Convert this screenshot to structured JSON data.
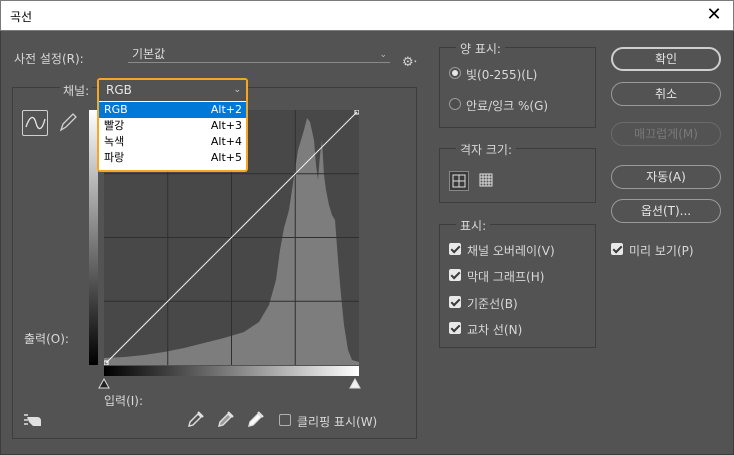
{
  "window": {
    "title": "곡선",
    "close_glyph": "✕"
  },
  "preset": {
    "label": "사전 설정(R):",
    "value": "기본값"
  },
  "channel": {
    "label": "채널:",
    "selected": "RGB",
    "options": [
      {
        "name": "RGB",
        "shortcut": "Alt+2"
      },
      {
        "name": "빨강",
        "shortcut": "Alt+3"
      },
      {
        "name": "녹색",
        "shortcut": "Alt+4"
      },
      {
        "name": "파랑",
        "shortcut": "Alt+5"
      }
    ]
  },
  "graph": {
    "output_label": "출력(O):",
    "input_label": "입력(I):"
  },
  "clipping": {
    "label": "클리핑 표시(W)",
    "checked": false
  },
  "amount": {
    "title": "양 표시:",
    "options": [
      {
        "label": "빛(0-255)(L)",
        "selected": true
      },
      {
        "label": "안료/잉크 %(G)",
        "selected": false
      }
    ]
  },
  "grid_size": {
    "title": "격자 크기:"
  },
  "display": {
    "title": "표시:",
    "options": [
      {
        "label": "채널 오버레이(V)",
        "checked": true
      },
      {
        "label": "막대 그래프(H)",
        "checked": true
      },
      {
        "label": "기준선(B)",
        "checked": true
      },
      {
        "label": "교차 선(N)",
        "checked": true
      }
    ]
  },
  "buttons": {
    "ok": "확인",
    "cancel": "취소",
    "smooth": "매끄럽게(M)",
    "auto": "자동(A)",
    "options": "옵션(T)..."
  },
  "preview": {
    "label": "미리 보기(P)",
    "checked": true
  },
  "colors": {
    "accent_highlight": "#f5a623",
    "selection": "#0078d7",
    "background": "#535353"
  }
}
